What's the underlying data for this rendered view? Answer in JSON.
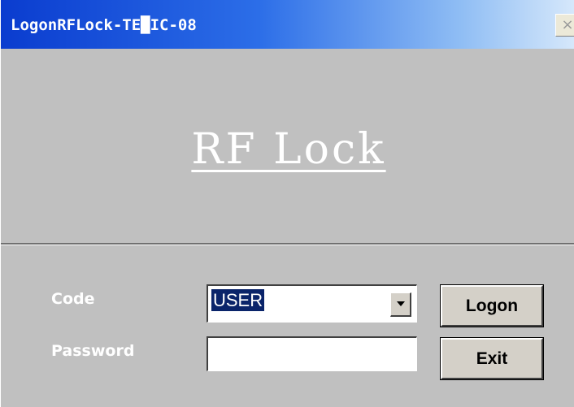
{
  "window": {
    "title": "LogonRFLock-TE█IC-08",
    "close_glyph": "×"
  },
  "banner": {
    "app_title": "RF Lock"
  },
  "form": {
    "code_label": "Code",
    "code_value": "USER",
    "password_label": "Password",
    "password_value": ""
  },
  "buttons": {
    "logon_label": "Logon",
    "exit_label": "Exit"
  },
  "colors": {
    "titlebar_start": "#0a3ccf",
    "titlebar_end": "#d6e8fb",
    "background": "#c0c0c0",
    "selection": "#0a246a"
  },
  "icons": {
    "close": "close-icon",
    "dropdown": "chevron-down-icon"
  }
}
